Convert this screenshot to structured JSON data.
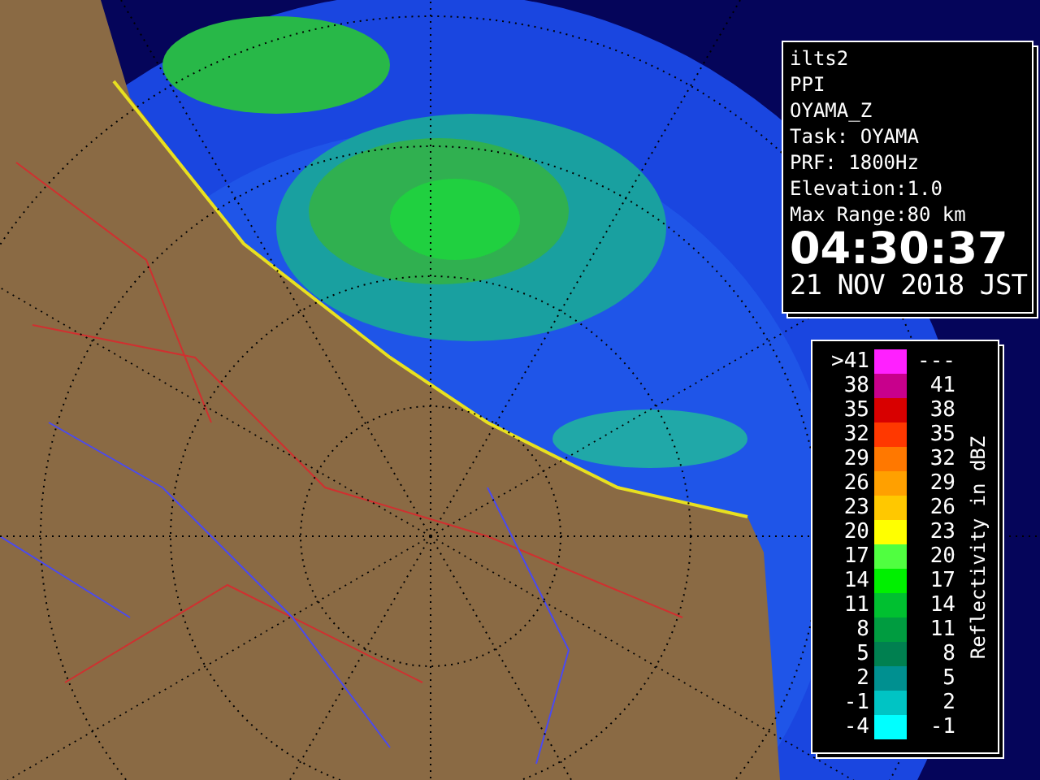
{
  "info": {
    "lines": [
      "ilts2",
      "PPI",
      "OYAMA_Z",
      "Task: OYAMA",
      "PRF: 1800Hz",
      "Elevation:1.0",
      "Max Range:80 km"
    ],
    "time": "04:30:37",
    "date": "21 NOV 2018 JST"
  },
  "legend": {
    "title": "Reflectivity in dBZ",
    "rows": [
      {
        "low": ">41",
        "high": "---",
        "color": "#ff20ff"
      },
      {
        "low": "38",
        "high": "41",
        "color": "#c8008c"
      },
      {
        "low": "35",
        "high": "38",
        "color": "#d80000"
      },
      {
        "low": "32",
        "high": "35",
        "color": "#ff3800"
      },
      {
        "low": "29",
        "high": "32",
        "color": "#ff7800"
      },
      {
        "low": "26",
        "high": "29",
        "color": "#ffa000"
      },
      {
        "low": "23",
        "high": "26",
        "color": "#ffc800"
      },
      {
        "low": "20",
        "high": "23",
        "color": "#ffff00"
      },
      {
        "low": "17",
        "high": "20",
        "color": "#50ff40"
      },
      {
        "low": "14",
        "high": "17",
        "color": "#00f000"
      },
      {
        "low": "11",
        "high": "14",
        "color": "#00c030"
      },
      {
        "low": "8",
        "high": "11",
        "color": "#009c40"
      },
      {
        "low": "5",
        "high": "8",
        "color": "#008050"
      },
      {
        "low": "2",
        "high": "5",
        "color": "#009090"
      },
      {
        "low": "-1",
        "high": "2",
        "color": "#00c4c4"
      },
      {
        "low": "-4",
        "high": "-1",
        "color": "#00ffff"
      }
    ]
  }
}
